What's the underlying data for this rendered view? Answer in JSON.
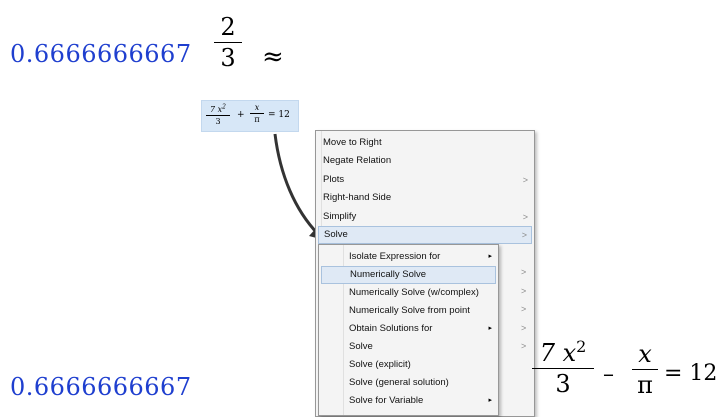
{
  "top_result": "0.6666666667",
  "top_fraction": {
    "numerator": "2",
    "denominator": "3"
  },
  "approx_symbol": "≈",
  "bottom_result": "0.6666666667",
  "thumbnail_equation": {
    "term1_num": "7 x",
    "term1_exp": "2",
    "term1_den": "3",
    "plus": "+",
    "term2_num": "x",
    "term2_den": "π",
    "equals": "= 12"
  },
  "context_menu": {
    "items": [
      {
        "label": "Move to Right",
        "submenu": ""
      },
      {
        "label": "Negate Relation",
        "submenu": ""
      },
      {
        "label": "Plots",
        "submenu": ">"
      },
      {
        "label": "Right-hand Side",
        "submenu": ""
      },
      {
        "label": "Simplify",
        "submenu": ">"
      },
      {
        "label": "Solve",
        "submenu": ">"
      }
    ],
    "highlighted": "Solve"
  },
  "solve_submenu": {
    "items": [
      {
        "label": "Isolate Expression for",
        "submenu": "▸"
      },
      {
        "label": "Numerically Solve",
        "submenu": ""
      },
      {
        "label": "Numerically Solve (w/complex)",
        "submenu": ""
      },
      {
        "label": "Numerically Solve from point",
        "submenu": ""
      },
      {
        "label": "Obtain Solutions for",
        "submenu": "▸"
      },
      {
        "label": "Solve",
        "submenu": ""
      },
      {
        "label": "Solve (explicit)",
        "submenu": ""
      },
      {
        "label": "Solve (general solution)",
        "submenu": ""
      },
      {
        "label": "Solve for Variable",
        "submenu": "▸"
      }
    ],
    "highlighted": "Numerically Solve"
  },
  "right_edge_markers": [
    ">",
    ">",
    ">",
    ">",
    ">"
  ],
  "large_equation": {
    "term1_num": "7 x",
    "term1_exp": "2",
    "term1_den": "3",
    "minus": "–",
    "term2_num": "x",
    "term2_den": "π",
    "equals": "= 12"
  },
  "colors": {
    "result_blue": "#1f3fcf",
    "menu_highlight": "#dfe9f5",
    "thumbnail_bg": "#d7e7f7"
  }
}
